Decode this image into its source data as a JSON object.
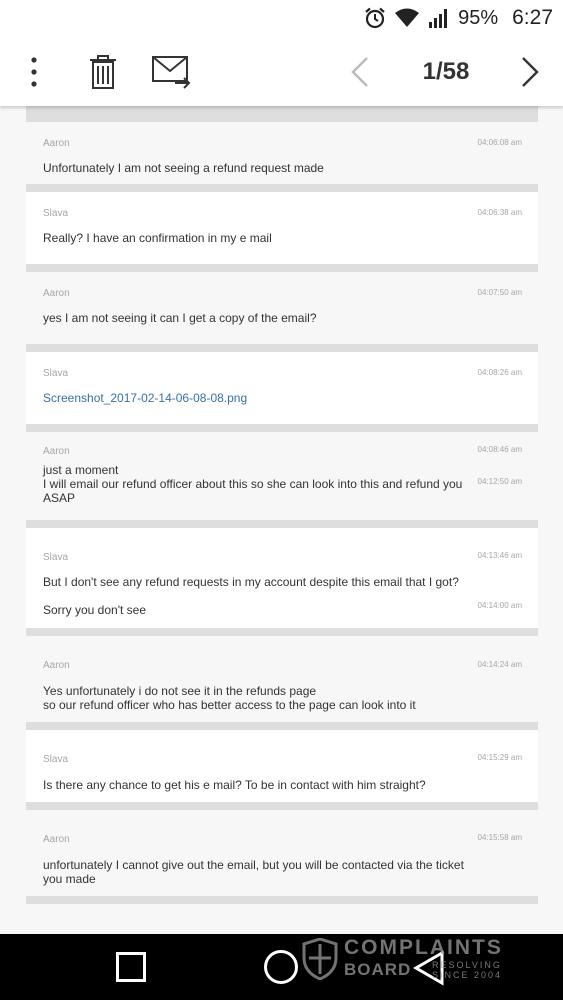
{
  "status": {
    "battery": "95%",
    "clock": "6:27"
  },
  "toolbar": {
    "counter": "1/58"
  },
  "messages": [
    {
      "sender": "Aaron",
      "time": "04:06:08 am",
      "text": "Unfortunately I am not seeing a refund request made"
    },
    {
      "sender": "Slava",
      "time": "04:06:38 am",
      "text": "Really? I have an confirmation in my e mail"
    },
    {
      "sender": "Aaron",
      "time": "04:07:50 am",
      "text": "yes I am not seeing it can I get a copy of the email?"
    },
    {
      "sender": "Slava",
      "time": "04:08:26 am",
      "text": "Screenshot_2017-02-14-06-08-08.png"
    },
    {
      "sender": "Aaron",
      "time": "04:08:46 am",
      "text": "just a moment",
      "time2": "04:12:50 am",
      "text2": "I will email our refund officer about this so she can look into this and refund you ASAP"
    },
    {
      "sender": "Slava",
      "time": "04:13:46 am",
      "text": "But I don't see any refund requests in my account despite this email that I got?",
      "time2": "04:14:00 am",
      "text2": "Sorry you don't see"
    },
    {
      "sender": "Aaron",
      "time": "04:14:24 am",
      "text": "Yes unfortunately i do not see it in the refunds page",
      "text2": "so our refund officer who has better access to the page can look into it"
    },
    {
      "sender": "Slava",
      "time": "04:15:29 am",
      "text": "Is there any chance to get his e mail? To be in contact with him straight?"
    },
    {
      "sender": "Aaron",
      "time": "04:15:58 am",
      "text": "unfortunately I cannot give out the email, but you will be contacted via the ticket you made"
    }
  ],
  "watermark": {
    "line1": "COMPLAINTS",
    "line2": "BOARD",
    "tag1": "RESOLVING",
    "tag2": "SINCE 2004"
  }
}
